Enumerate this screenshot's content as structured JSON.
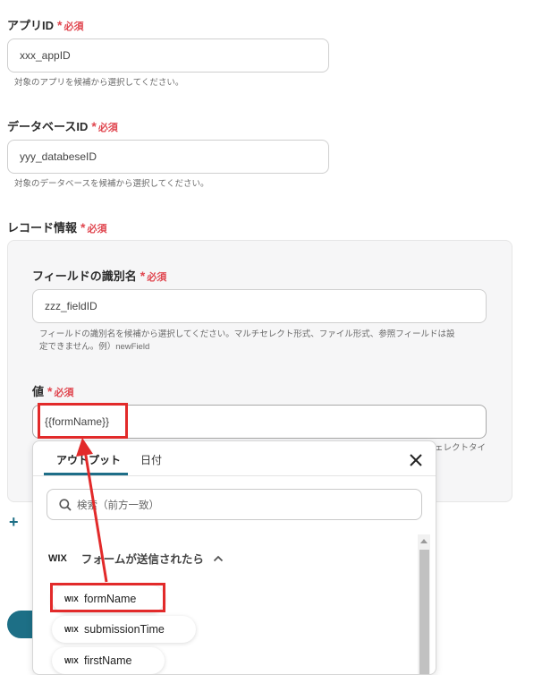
{
  "app_id": {
    "label": "アプリID",
    "required": "必須",
    "value": "xxx_appID",
    "help": "対象のアプリを候補から選択してください。"
  },
  "database_id": {
    "label": "データベースID",
    "required": "必須",
    "value": "yyy_databeseID",
    "help": "対象のデータベースを候補から選択してください。"
  },
  "record_info": {
    "label": "レコード情報",
    "required": "必須",
    "field_name": {
      "label": "フィールドの識別名",
      "required": "必須",
      "value": "zzz_fieldID",
      "help_line1": "フィールドの識別名を候補から選択してください。マルチセレクト形式、ファイル形式、参照フィールドは設",
      "help_line2": "定できません。例）newField"
    },
    "value_field": {
      "label": "値",
      "required": "必須",
      "value": "{{formName}}",
      "help_partial": "ェレクトタイ"
    }
  },
  "add_icon": "+",
  "dropdown": {
    "tabs": [
      {
        "label": "アウトプット",
        "active": true
      },
      {
        "label": "日付",
        "active": false
      }
    ],
    "search_placeholder": "検索（前方一致）",
    "group": {
      "logo": "WIX",
      "title": "フォームが送信されたら"
    },
    "items": [
      {
        "logo": "WIX",
        "label": "formName"
      },
      {
        "logo": "WIX",
        "label": "submissionTime"
      },
      {
        "logo": "WIX",
        "label": "firstName"
      }
    ]
  },
  "colors": {
    "required": "#e0464f",
    "annotation": "#e22a2a",
    "tab_underline": "#1e6e88",
    "button_teal": "#1d6f86"
  }
}
